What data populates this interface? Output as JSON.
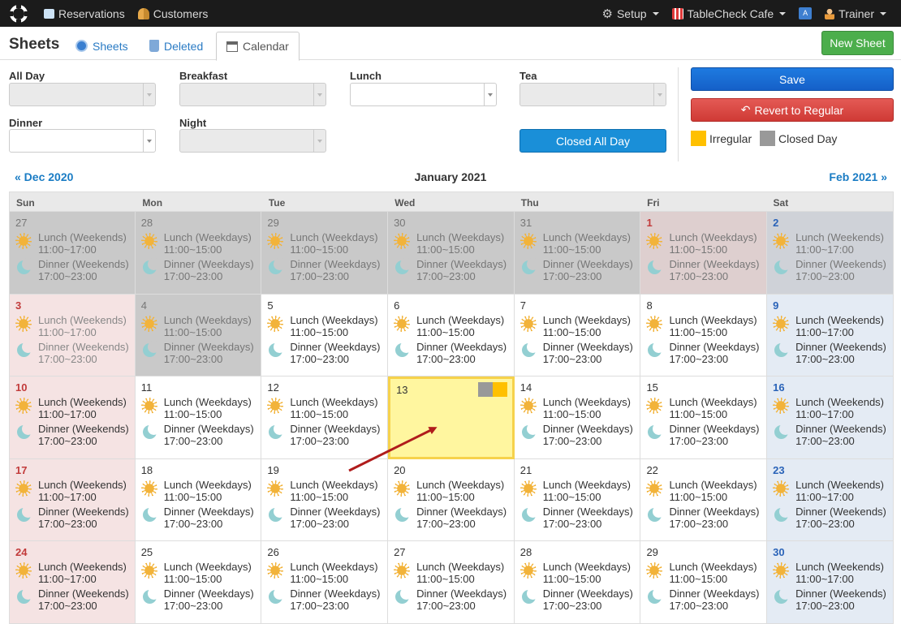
{
  "nav": {
    "items": [
      {
        "label": "Reservations",
        "icon": "book-icon"
      },
      {
        "label": "Customers",
        "icon": "people-icon"
      }
    ],
    "right": [
      {
        "label": "Setup",
        "icon": "gear-icon"
      },
      {
        "label": "TableCheck Cafe",
        "icon": "store-icon"
      },
      {
        "label": "",
        "icon": "translate-icon"
      },
      {
        "label": "Trainer",
        "icon": "person-icon"
      }
    ]
  },
  "header": {
    "title": "Sheets",
    "tabs": [
      {
        "label": "Sheets"
      },
      {
        "label": "Deleted"
      },
      {
        "label": "Calendar"
      }
    ],
    "new_sheet": "New Sheet"
  },
  "filters": {
    "all_day": "All Day",
    "breakfast": "Breakfast",
    "lunch": "Lunch",
    "tea": "Tea",
    "dinner": "Dinner",
    "night": "Night",
    "closed_all_day": "Closed All Day"
  },
  "actions": {
    "save": "Save",
    "revert": "Revert to Regular"
  },
  "legend": {
    "irregular": "Irregular",
    "closed_day": "Closed Day",
    "irregular_color": "#ffc000",
    "closed_color": "#999999"
  },
  "calendar": {
    "prev": "« Dec 2020",
    "title": "January 2021",
    "next": "Feb 2021 »",
    "weekdays": [
      "Sun",
      "Mon",
      "Tue",
      "Wed",
      "Thu",
      "Fri",
      "Sat"
    ],
    "weeks": [
      [
        {
          "day": "27",
          "style": "grey",
          "numClass": "muted",
          "shifts": [
            {
              "name": "Lunch (Weekends)",
              "time": "11:00~17:00"
            },
            {
              "name": "Dinner (Weekends)",
              "time": "17:00~23:00"
            }
          ]
        },
        {
          "day": "28",
          "style": "grey",
          "numClass": "muted",
          "shifts": [
            {
              "name": "Lunch (Weekdays)",
              "time": "11:00~15:00"
            },
            {
              "name": "Dinner (Weekdays)",
              "time": "17:00~23:00"
            }
          ]
        },
        {
          "day": "29",
          "style": "grey",
          "numClass": "muted",
          "shifts": [
            {
              "name": "Lunch (Weekdays)",
              "time": "11:00~15:00"
            },
            {
              "name": "Dinner (Weekdays)",
              "time": "17:00~23:00"
            }
          ]
        },
        {
          "day": "30",
          "style": "grey",
          "numClass": "muted",
          "shifts": [
            {
              "name": "Lunch (Weekdays)",
              "time": "11:00~15:00"
            },
            {
              "name": "Dinner (Weekdays)",
              "time": "17:00~23:00"
            }
          ]
        },
        {
          "day": "31",
          "style": "grey",
          "numClass": "muted",
          "shifts": [
            {
              "name": "Lunch (Weekdays)",
              "time": "11:00~15:00"
            },
            {
              "name": "Dinner (Weekdays)",
              "time": "17:00~23:00"
            }
          ]
        },
        {
          "day": "1",
          "style": "fripink",
          "numClass": "red",
          "shifts": [
            {
              "name": "Lunch (Weekdays)",
              "time": "11:00~15:00"
            },
            {
              "name": "Dinner (Weekdays)",
              "time": "17:00~23:00"
            }
          ]
        },
        {
          "day": "2",
          "style": "satgrey",
          "numClass": "blue",
          "shifts": [
            {
              "name": "Lunch (Weekends)",
              "time": "11:00~17:00"
            },
            {
              "name": "Dinner (Weekends)",
              "time": "17:00~23:00"
            }
          ]
        }
      ],
      [
        {
          "day": "3",
          "style": "sun dim",
          "numClass": "red",
          "shifts": [
            {
              "name": "Lunch (Weekends)",
              "time": "11:00~17:00"
            },
            {
              "name": "Dinner (Weekends)",
              "time": "17:00~23:00"
            }
          ]
        },
        {
          "day": "4",
          "style": "grey",
          "numClass": "muted",
          "shifts": [
            {
              "name": "Lunch (Weekdays)",
              "time": "11:00~15:00"
            },
            {
              "name": "Dinner (Weekdays)",
              "time": "17:00~23:00"
            }
          ]
        },
        {
          "day": "5",
          "style": "",
          "numClass": "",
          "shifts": [
            {
              "name": "Lunch (Weekdays)",
              "time": "11:00~15:00"
            },
            {
              "name": "Dinner (Weekdays)",
              "time": "17:00~23:00"
            }
          ]
        },
        {
          "day": "6",
          "style": "",
          "numClass": "",
          "shifts": [
            {
              "name": "Lunch (Weekdays)",
              "time": "11:00~15:00"
            },
            {
              "name": "Dinner (Weekdays)",
              "time": "17:00~23:00"
            }
          ]
        },
        {
          "day": "7",
          "style": "",
          "numClass": "",
          "shifts": [
            {
              "name": "Lunch (Weekdays)",
              "time": "11:00~15:00"
            },
            {
              "name": "Dinner (Weekdays)",
              "time": "17:00~23:00"
            }
          ]
        },
        {
          "day": "8",
          "style": "",
          "numClass": "",
          "shifts": [
            {
              "name": "Lunch (Weekdays)",
              "time": "11:00~15:00"
            },
            {
              "name": "Dinner (Weekdays)",
              "time": "17:00~23:00"
            }
          ]
        },
        {
          "day": "9",
          "style": "sat",
          "numClass": "blue",
          "shifts": [
            {
              "name": "Lunch (Weekends)",
              "time": "11:00~17:00"
            },
            {
              "name": "Dinner (Weekends)",
              "time": "17:00~23:00"
            }
          ]
        }
      ],
      [
        {
          "day": "10",
          "style": "sun",
          "numClass": "red",
          "shifts": [
            {
              "name": "Lunch (Weekends)",
              "time": "11:00~17:00"
            },
            {
              "name": "Dinner (Weekends)",
              "time": "17:00~23:00"
            }
          ]
        },
        {
          "day": "11",
          "style": "",
          "numClass": "",
          "shifts": [
            {
              "name": "Lunch (Weekdays)",
              "time": "11:00~15:00"
            },
            {
              "name": "Dinner (Weekdays)",
              "time": "17:00~23:00"
            }
          ]
        },
        {
          "day": "12",
          "style": "",
          "numClass": "",
          "shifts": [
            {
              "name": "Lunch (Weekdays)",
              "time": "11:00~15:00"
            },
            {
              "name": "Dinner (Weekdays)",
              "time": "17:00~23:00"
            }
          ]
        },
        {
          "day": "13",
          "style": "sel",
          "numClass": "",
          "swatches": true,
          "shifts": []
        },
        {
          "day": "14",
          "style": "",
          "numClass": "",
          "shifts": [
            {
              "name": "Lunch (Weekdays)",
              "time": "11:00~15:00"
            },
            {
              "name": "Dinner (Weekdays)",
              "time": "17:00~23:00"
            }
          ]
        },
        {
          "day": "15",
          "style": "",
          "numClass": "",
          "shifts": [
            {
              "name": "Lunch (Weekdays)",
              "time": "11:00~15:00"
            },
            {
              "name": "Dinner (Weekdays)",
              "time": "17:00~23:00"
            }
          ]
        },
        {
          "day": "16",
          "style": "sat",
          "numClass": "blue",
          "shifts": [
            {
              "name": "Lunch (Weekends)",
              "time": "11:00~17:00"
            },
            {
              "name": "Dinner (Weekends)",
              "time": "17:00~23:00"
            }
          ]
        }
      ],
      [
        {
          "day": "17",
          "style": "sun",
          "numClass": "red",
          "shifts": [
            {
              "name": "Lunch (Weekends)",
              "time": "11:00~17:00"
            },
            {
              "name": "Dinner (Weekends)",
              "time": "17:00~23:00"
            }
          ]
        },
        {
          "day": "18",
          "style": "",
          "numClass": "",
          "shifts": [
            {
              "name": "Lunch (Weekdays)",
              "time": "11:00~15:00"
            },
            {
              "name": "Dinner (Weekdays)",
              "time": "17:00~23:00"
            }
          ]
        },
        {
          "day": "19",
          "style": "",
          "numClass": "",
          "shifts": [
            {
              "name": "Lunch (Weekdays)",
              "time": "11:00~15:00"
            },
            {
              "name": "Dinner (Weekdays)",
              "time": "17:00~23:00"
            }
          ]
        },
        {
          "day": "20",
          "style": "",
          "numClass": "",
          "shifts": [
            {
              "name": "Lunch (Weekdays)",
              "time": "11:00~15:00"
            },
            {
              "name": "Dinner (Weekdays)",
              "time": "17:00~23:00"
            }
          ]
        },
        {
          "day": "21",
          "style": "",
          "numClass": "",
          "shifts": [
            {
              "name": "Lunch (Weekdays)",
              "time": "11:00~15:00"
            },
            {
              "name": "Dinner (Weekdays)",
              "time": "17:00~23:00"
            }
          ]
        },
        {
          "day": "22",
          "style": "",
          "numClass": "",
          "shifts": [
            {
              "name": "Lunch (Weekdays)",
              "time": "11:00~15:00"
            },
            {
              "name": "Dinner (Weekdays)",
              "time": "17:00~23:00"
            }
          ]
        },
        {
          "day": "23",
          "style": "sat",
          "numClass": "blue",
          "shifts": [
            {
              "name": "Lunch (Weekends)",
              "time": "11:00~17:00"
            },
            {
              "name": "Dinner (Weekends)",
              "time": "17:00~23:00"
            }
          ]
        }
      ],
      [
        {
          "day": "24",
          "style": "sun",
          "numClass": "red",
          "shifts": [
            {
              "name": "Lunch (Weekends)",
              "time": "11:00~17:00"
            },
            {
              "name": "Dinner (Weekends)",
              "time": "17:00~23:00"
            }
          ]
        },
        {
          "day": "25",
          "style": "",
          "numClass": "",
          "shifts": [
            {
              "name": "Lunch (Weekdays)",
              "time": "11:00~15:00"
            },
            {
              "name": "Dinner (Weekdays)",
              "time": "17:00~23:00"
            }
          ]
        },
        {
          "day": "26",
          "style": "",
          "numClass": "",
          "shifts": [
            {
              "name": "Lunch (Weekdays)",
              "time": "11:00~15:00"
            },
            {
              "name": "Dinner (Weekdays)",
              "time": "17:00~23:00"
            }
          ]
        },
        {
          "day": "27",
          "style": "",
          "numClass": "",
          "shifts": [
            {
              "name": "Lunch (Weekdays)",
              "time": "11:00~15:00"
            },
            {
              "name": "Dinner (Weekdays)",
              "time": "17:00~23:00"
            }
          ]
        },
        {
          "day": "28",
          "style": "",
          "numClass": "",
          "shifts": [
            {
              "name": "Lunch (Weekdays)",
              "time": "11:00~15:00"
            },
            {
              "name": "Dinner (Weekdays)",
              "time": "17:00~23:00"
            }
          ]
        },
        {
          "day": "29",
          "style": "",
          "numClass": "",
          "shifts": [
            {
              "name": "Lunch (Weekdays)",
              "time": "11:00~15:00"
            },
            {
              "name": "Dinner (Weekdays)",
              "time": "17:00~23:00"
            }
          ]
        },
        {
          "day": "30",
          "style": "sat",
          "numClass": "blue",
          "shifts": [
            {
              "name": "Lunch (Weekends)",
              "time": "11:00~17:00"
            },
            {
              "name": "Dinner (Weekends)",
              "time": "17:00~23:00"
            }
          ]
        }
      ]
    ]
  }
}
